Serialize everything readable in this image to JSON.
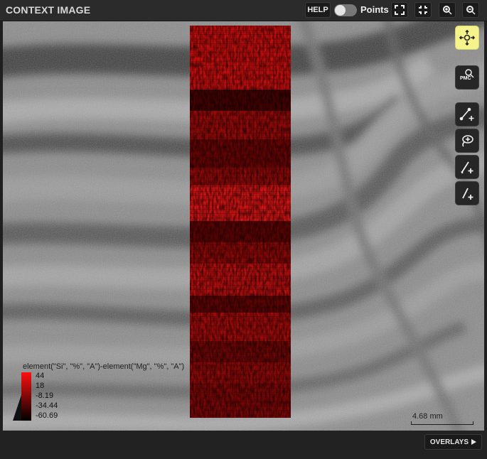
{
  "panel": {
    "title": "CONTEXT IMAGE"
  },
  "header": {
    "help_label": "HELP",
    "points_label": "Points",
    "points_toggle_on": false,
    "buttons": [
      {
        "icon": "expand-icon"
      },
      {
        "icon": "collapse-icon"
      },
      {
        "icon": "zoom-in-icon"
      },
      {
        "icon": "zoom-out-icon"
      }
    ]
  },
  "toolbar": {
    "tools": [
      {
        "icon": "pan-move-icon",
        "active": true
      },
      {
        "icon": "pmc-select-icon",
        "label": "PMC"
      },
      {
        "icon": "add-line-icon"
      },
      {
        "icon": "add-lasso-icon"
      },
      {
        "icon": "add-brush-icon"
      },
      {
        "icon": "add-brush-alt-icon"
      }
    ]
  },
  "legend": {
    "expression": "element(\"Si\", \"%\", \"A\")-element(\"Mg\", \"%\", \"A\")",
    "ticks": [
      "44",
      "18",
      "-8.19",
      "-34.44",
      "-60.69"
    ],
    "colors": {
      "high": "#ff1010",
      "low": "#000000"
    }
  },
  "scale": {
    "label": "4.68 mm"
  },
  "footer": {
    "overlays_label": "OVERLAYS"
  },
  "colors": {
    "accent_active_tool": "#f6f28c",
    "map_red": "#e01212"
  }
}
